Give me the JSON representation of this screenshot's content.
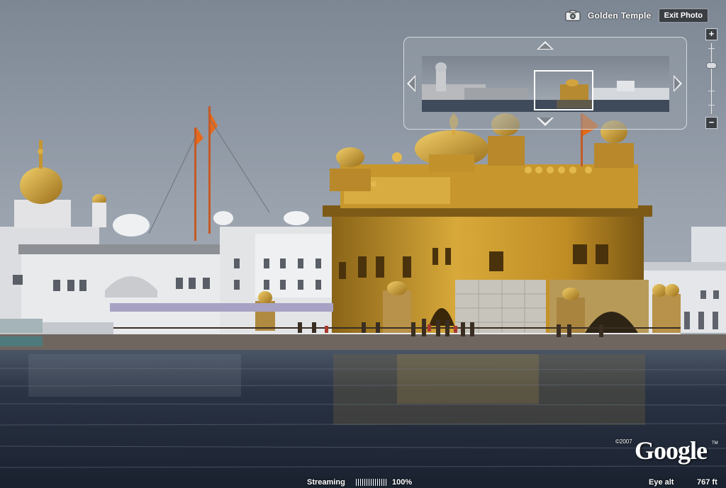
{
  "header": {
    "title": "Golden Temple",
    "exit_label": "Exit Photo",
    "icon": "camera-icon"
  },
  "navigator": {
    "icons": [
      "arrow-up-icon",
      "arrow-down-icon",
      "arrow-left-icon",
      "arrow-right-icon"
    ]
  },
  "zoom": {
    "in_label": "+",
    "out_label": "−",
    "level_fraction": 0.7
  },
  "branding": {
    "copyright": "©2007",
    "logo": "Google",
    "tm": "TM"
  },
  "status": {
    "streaming_label": "Streaming",
    "streaming_percent": "100%",
    "streaming_fraction": 1.0,
    "eye_alt_label": "Eye alt",
    "eye_alt_value": "767 ft"
  },
  "colors": {
    "sky": "#8c96a3",
    "gold": "#c79a2a",
    "water": "#1f2a3a",
    "panel": "#3b3e43"
  }
}
